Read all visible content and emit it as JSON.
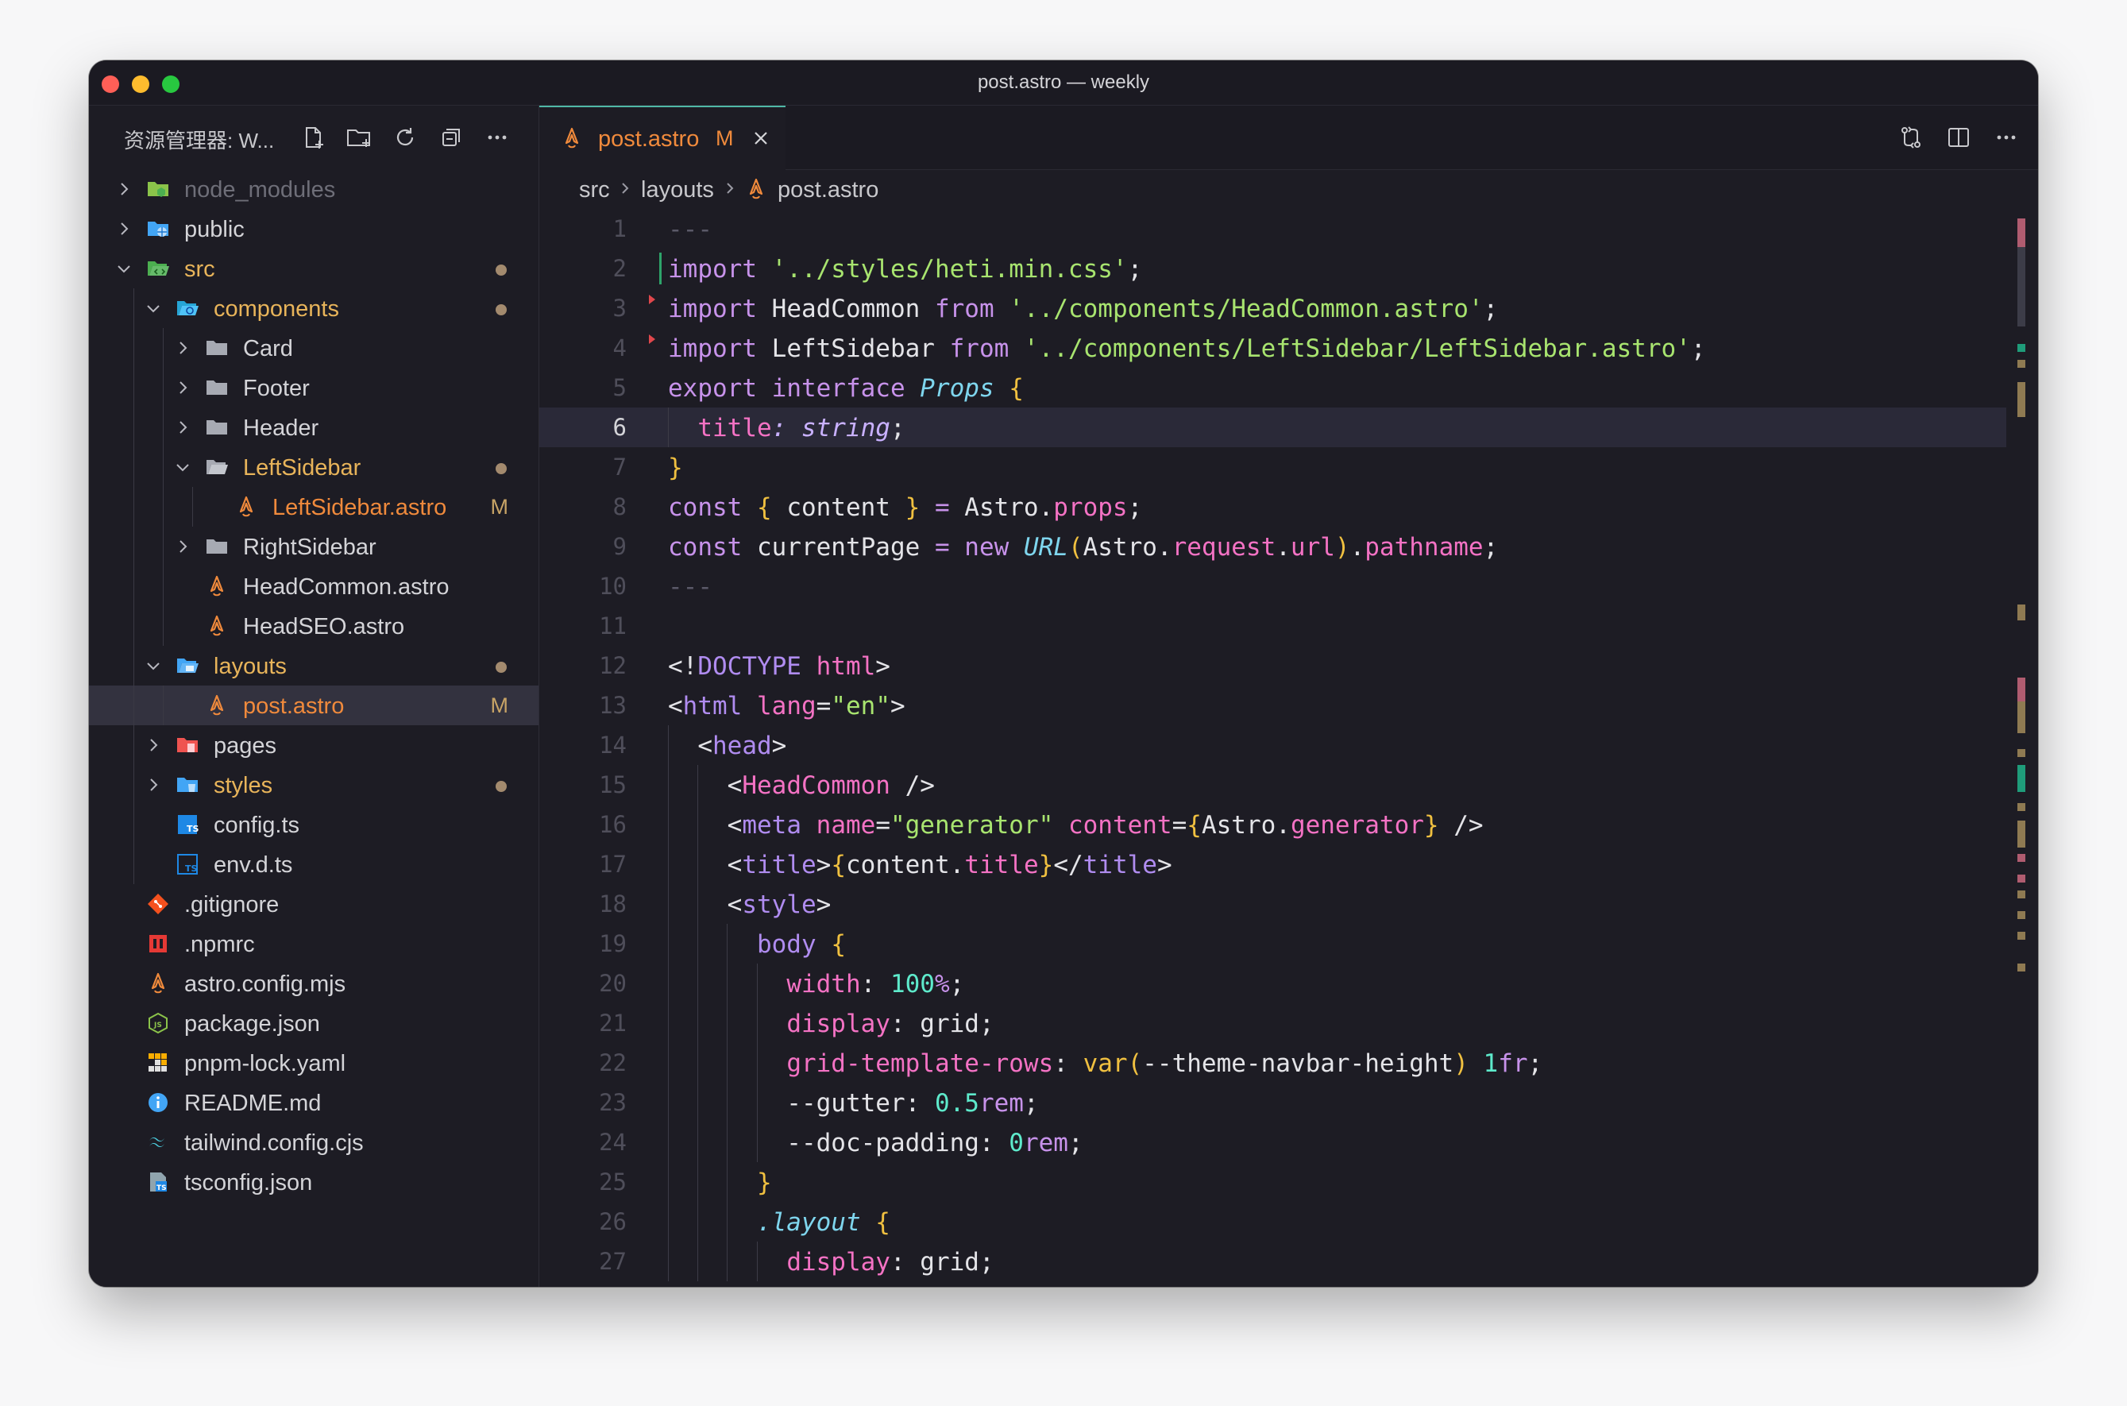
{
  "window": {
    "title": "post.astro — weekly"
  },
  "sidebar": {
    "title": "资源管理器: W...",
    "tree": [
      {
        "label": "node_modules",
        "depth": 0,
        "kind": "folder-node",
        "chevron": "right",
        "state": "dim"
      },
      {
        "label": "public",
        "depth": 0,
        "kind": "folder-public",
        "chevron": "right",
        "state": "normal"
      },
      {
        "label": "src",
        "depth": 0,
        "kind": "folder-src",
        "chevron": "down",
        "state": "modified",
        "dot": true
      },
      {
        "label": "components",
        "depth": 1,
        "kind": "folder-components",
        "chevron": "down",
        "state": "modified",
        "dot": true
      },
      {
        "label": "Card",
        "depth": 2,
        "kind": "folder",
        "chevron": "right",
        "state": "normal"
      },
      {
        "label": "Footer",
        "depth": 2,
        "kind": "folder",
        "chevron": "right",
        "state": "normal"
      },
      {
        "label": "Header",
        "depth": 2,
        "kind": "folder",
        "chevron": "right",
        "state": "normal"
      },
      {
        "label": "LeftSidebar",
        "depth": 2,
        "kind": "folder-open",
        "chevron": "down",
        "state": "modified",
        "dot": true
      },
      {
        "label": "LeftSidebar.astro",
        "depth": 3,
        "kind": "astro",
        "chevron": "none",
        "state": "astro-mod",
        "badge": "M"
      },
      {
        "label": "RightSidebar",
        "depth": 2,
        "kind": "folder",
        "chevron": "right",
        "state": "normal"
      },
      {
        "label": "HeadCommon.astro",
        "depth": 2,
        "kind": "astro",
        "chevron": "none",
        "state": "normal"
      },
      {
        "label": "HeadSEO.astro",
        "depth": 2,
        "kind": "astro",
        "chevron": "none",
        "state": "normal"
      },
      {
        "label": "layouts",
        "depth": 1,
        "kind": "folder-layouts",
        "chevron": "down",
        "state": "modified",
        "dot": true
      },
      {
        "label": "post.astro",
        "depth": 2,
        "kind": "astro",
        "chevron": "none",
        "state": "astro-mod",
        "badge": "M",
        "selected": true
      },
      {
        "label": "pages",
        "depth": 1,
        "kind": "folder-pages",
        "chevron": "right",
        "state": "normal"
      },
      {
        "label": "styles",
        "depth": 1,
        "kind": "folder-styles",
        "chevron": "right",
        "state": "modified",
        "dot": true
      },
      {
        "label": "config.ts",
        "depth": 1,
        "kind": "ts",
        "chevron": "none",
        "state": "normal"
      },
      {
        "label": "env.d.ts",
        "depth": 1,
        "kind": "dts",
        "chevron": "none",
        "state": "normal"
      },
      {
        "label": ".gitignore",
        "depth": 0,
        "kind": "git",
        "chevron": "none",
        "state": "normal"
      },
      {
        "label": ".npmrc",
        "depth": 0,
        "kind": "npm",
        "chevron": "none",
        "state": "normal"
      },
      {
        "label": "astro.config.mjs",
        "depth": 0,
        "kind": "astro",
        "chevron": "none",
        "state": "normal"
      },
      {
        "label": "package.json",
        "depth": 0,
        "kind": "node",
        "chevron": "none",
        "state": "normal"
      },
      {
        "label": "pnpm-lock.yaml",
        "depth": 0,
        "kind": "pnpm",
        "chevron": "none",
        "state": "normal"
      },
      {
        "label": "README.md",
        "depth": 0,
        "kind": "info",
        "chevron": "none",
        "state": "normal"
      },
      {
        "label": "tailwind.config.cjs",
        "depth": 0,
        "kind": "tailwind",
        "chevron": "none",
        "state": "normal"
      },
      {
        "label": "tsconfig.json",
        "depth": 0,
        "kind": "tsconfig",
        "chevron": "none",
        "state": "normal"
      }
    ]
  },
  "editor": {
    "tab": {
      "label": "post.astro",
      "badge": "M"
    },
    "breadcrumb": [
      "src",
      "layouts",
      "post.astro"
    ],
    "active_line": 6,
    "lines": [
      [
        [
          "cm",
          "---"
        ]
      ],
      [
        [
          "k",
          "import "
        ],
        [
          "s",
          "'../styles/heti.min.css'"
        ],
        [
          "fn",
          ";"
        ]
      ],
      [
        [
          "k",
          "import "
        ],
        [
          "fn",
          "HeadCommon "
        ],
        [
          "k",
          "from "
        ],
        [
          "s",
          "'../components/HeadCommon.astro'"
        ],
        [
          "fn",
          ";"
        ]
      ],
      [
        [
          "k",
          "import "
        ],
        [
          "fn",
          "LeftSidebar "
        ],
        [
          "k",
          "from "
        ],
        [
          "s",
          "'../components/LeftSidebar/LeftSidebar.astro'"
        ],
        [
          "fn",
          ";"
        ]
      ],
      [
        [
          "k",
          "export "
        ],
        [
          "k",
          "interface "
        ],
        [
          "t",
          "Props "
        ],
        [
          "p",
          "{"
        ]
      ],
      [
        [
          "fn",
          "  "
        ],
        [
          "at",
          "title"
        ],
        [
          "ty",
          ": string"
        ],
        [
          "fn",
          ";"
        ]
      ],
      [
        [
          "p",
          "}"
        ]
      ],
      [
        [
          "k",
          "const "
        ],
        [
          "p",
          "{ "
        ],
        [
          "fn",
          "content "
        ],
        [
          "p",
          "} "
        ],
        [
          "k",
          "= "
        ],
        [
          "fn",
          "Astro."
        ],
        [
          "prop",
          "props"
        ],
        [
          "fn",
          ";"
        ]
      ],
      [
        [
          "k",
          "const "
        ],
        [
          "fn",
          "currentPage "
        ],
        [
          "k",
          "= new "
        ],
        [
          "t",
          "URL"
        ],
        [
          "p",
          "("
        ],
        [
          "fn",
          "Astro."
        ],
        [
          "prop",
          "request"
        ],
        [
          "fn",
          "."
        ],
        [
          "prop",
          "url"
        ],
        [
          "p",
          ")"
        ],
        [
          "fn",
          "."
        ],
        [
          "prop",
          "pathname"
        ],
        [
          "fn",
          ";"
        ]
      ],
      [
        [
          "cm",
          "---"
        ]
      ],
      [],
      [
        [
          "fn",
          "<!"
        ],
        [
          "tg",
          "DOCTYPE "
        ],
        [
          "at",
          "html"
        ],
        [
          "fn",
          ">"
        ]
      ],
      [
        [
          "fn",
          "<"
        ],
        [
          "tg",
          "html "
        ],
        [
          "at",
          "lang"
        ],
        [
          "fn",
          "="
        ],
        [
          "s",
          "\"en\""
        ],
        [
          "fn",
          ">"
        ]
      ],
      [
        [
          "fn",
          "  <"
        ],
        [
          "tg",
          "head"
        ],
        [
          "fn",
          ">"
        ]
      ],
      [
        [
          "fn",
          "    <"
        ],
        [
          "at",
          "HeadCommon"
        ],
        [
          "fn",
          " />"
        ]
      ],
      [
        [
          "fn",
          "    <"
        ],
        [
          "tg",
          "meta "
        ],
        [
          "at",
          "name"
        ],
        [
          "fn",
          "="
        ],
        [
          "s",
          "\"generator\" "
        ],
        [
          "at",
          "content"
        ],
        [
          "fn",
          "="
        ],
        [
          "p",
          "{"
        ],
        [
          "fn",
          "Astro."
        ],
        [
          "prop",
          "generator"
        ],
        [
          "p",
          "}"
        ],
        [
          "fn",
          " />"
        ]
      ],
      [
        [
          "fn",
          "    <"
        ],
        [
          "tg",
          "title"
        ],
        [
          "fn",
          ">"
        ],
        [
          "p",
          "{"
        ],
        [
          "fn",
          "content."
        ],
        [
          "prop",
          "title"
        ],
        [
          "p",
          "}"
        ],
        [
          "fn",
          "</"
        ],
        [
          "tg",
          "title"
        ],
        [
          "fn",
          ">"
        ]
      ],
      [
        [
          "fn",
          "    <"
        ],
        [
          "tg",
          "style"
        ],
        [
          "fn",
          ">"
        ]
      ],
      [
        [
          "fn",
          "      "
        ],
        [
          "tg",
          "body "
        ],
        [
          "p",
          "{"
        ]
      ],
      [
        [
          "fn",
          "        "
        ],
        [
          "at",
          "width"
        ],
        [
          "fn",
          ": "
        ],
        [
          "n",
          "100"
        ],
        [
          "k",
          "%"
        ],
        [
          "fn",
          ";"
        ]
      ],
      [
        [
          "fn",
          "        "
        ],
        [
          "at",
          "display"
        ],
        [
          "fn",
          ": grid;"
        ]
      ],
      [
        [
          "fn",
          "        "
        ],
        [
          "at",
          "grid-template-rows"
        ],
        [
          "fn",
          ": "
        ],
        [
          "p",
          "var"
        ],
        [
          "p",
          "("
        ],
        [
          "fn",
          "--theme-navbar-height"
        ],
        [
          "p",
          ")"
        ],
        [
          "fn",
          " "
        ],
        [
          "n",
          "1"
        ],
        [
          "k",
          "fr"
        ],
        [
          "fn",
          ";"
        ]
      ],
      [
        [
          "fn",
          "        --gutter: "
        ],
        [
          "n",
          "0.5"
        ],
        [
          "k",
          "rem"
        ],
        [
          "fn",
          ";"
        ]
      ],
      [
        [
          "fn",
          "        --doc-padding: "
        ],
        [
          "n",
          "0"
        ],
        [
          "k",
          "rem"
        ],
        [
          "fn",
          ";"
        ]
      ],
      [
        [
          "fn",
          "      "
        ],
        [
          "p",
          "}"
        ]
      ],
      [
        [
          "fn",
          "      "
        ],
        [
          "t",
          ".layout "
        ],
        [
          "p",
          "{"
        ]
      ],
      [
        [
          "fn",
          "        "
        ],
        [
          "at",
          "display"
        ],
        [
          "fn",
          ": grid;"
        ]
      ]
    ]
  },
  "colors": {
    "accent": "#4fb8a6",
    "modified": "#e8b45a",
    "astro": "#f08a3c"
  }
}
